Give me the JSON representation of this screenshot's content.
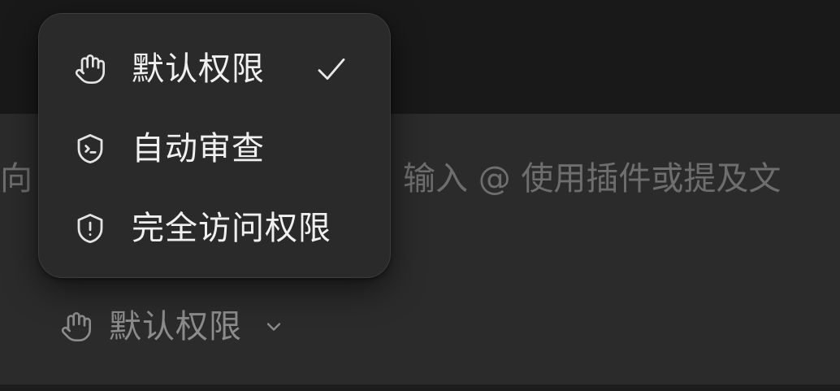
{
  "composer": {
    "placeholder_start": "向",
    "placeholder_end": "输入 @ 使用插件或提及文"
  },
  "permission_selector": {
    "current_label": "默认权限",
    "icon": "hand-icon",
    "chevron_icon": "chevron-down-icon"
  },
  "permission_menu": {
    "items": [
      {
        "label": "默认权限",
        "icon": "hand-icon",
        "selected": true
      },
      {
        "label": "自动审查",
        "icon": "shield-terminal-icon",
        "selected": false
      },
      {
        "label": "完全访问权限",
        "icon": "shield-alert-icon",
        "selected": false
      }
    ],
    "check_icon": "check-icon"
  }
}
